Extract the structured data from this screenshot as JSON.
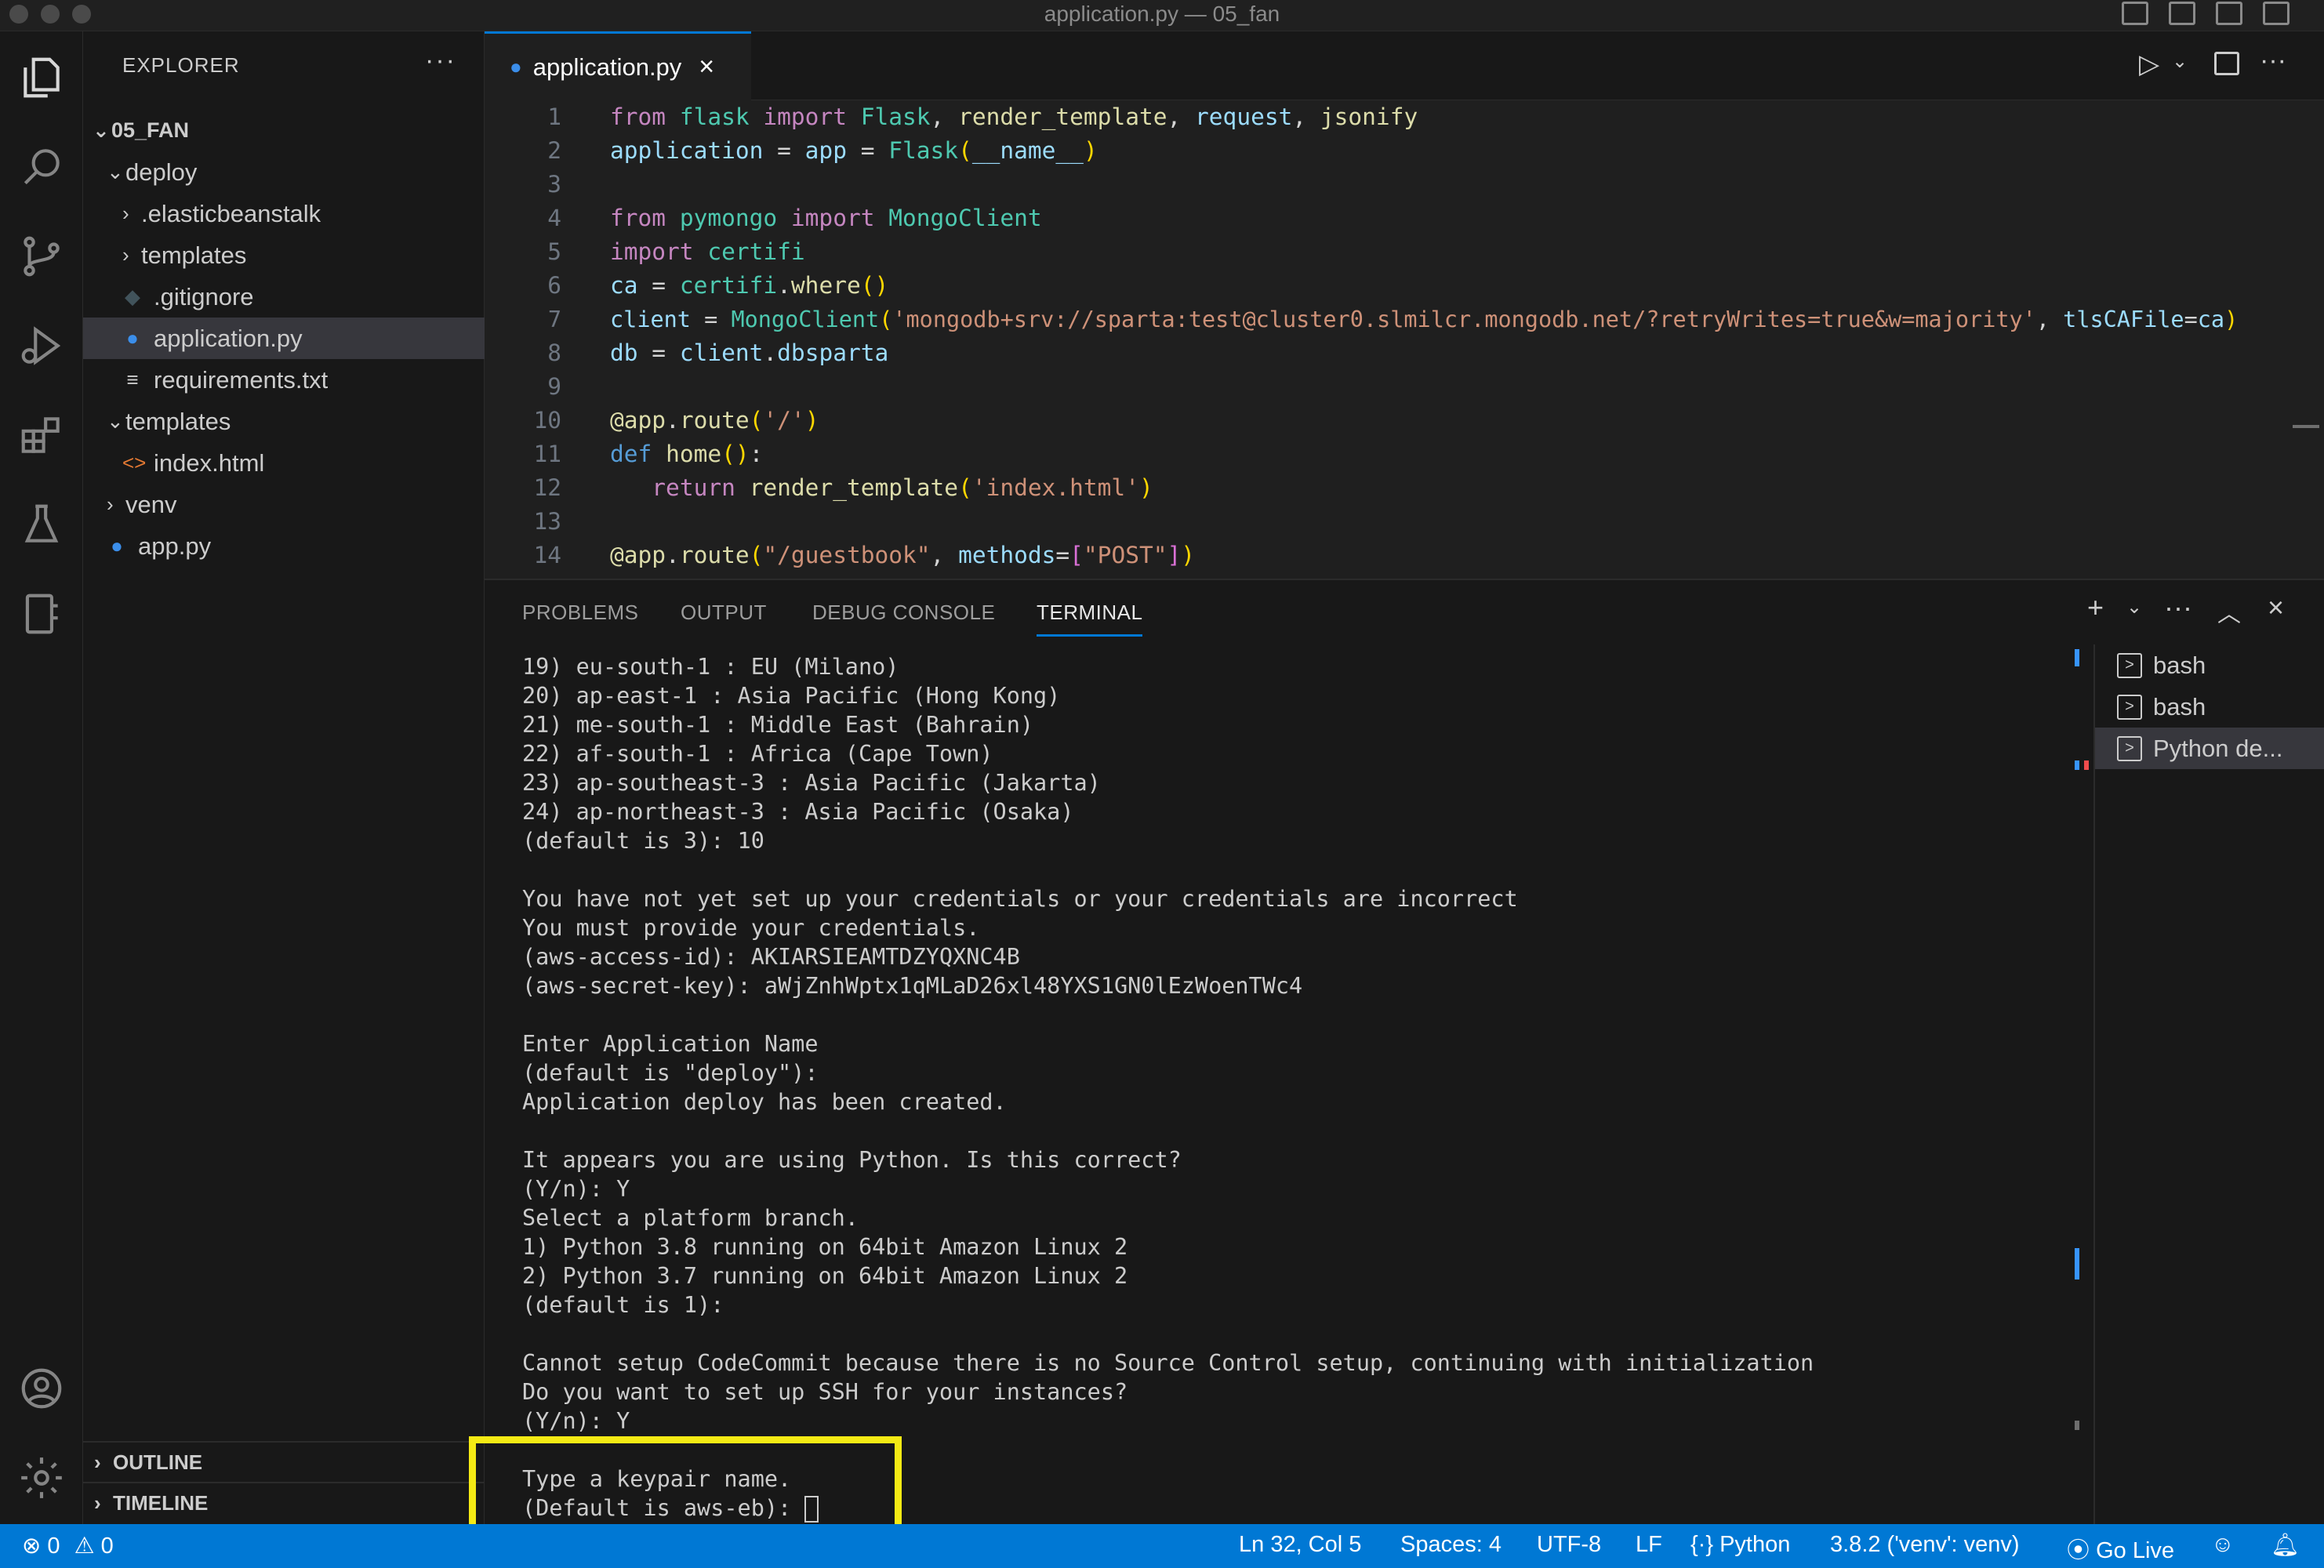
{
  "window": {
    "title": "application.py — 05_fan"
  },
  "sidebar": {
    "title": "EXPLORER",
    "more": "···",
    "tree": [
      {
        "label": "05_FAN",
        "kind": "root-folder"
      },
      {
        "label": "deploy",
        "kind": "folder-open"
      },
      {
        "label": ".elasticbeanstalk",
        "kind": "folder-closed"
      },
      {
        "label": "templates",
        "kind": "folder-closed"
      },
      {
        "label": ".gitignore",
        "kind": "git-file"
      },
      {
        "label": "application.py",
        "kind": "python-file"
      },
      {
        "label": "requirements.txt",
        "kind": "text-file"
      },
      {
        "label": "templates",
        "kind": "folder-open"
      },
      {
        "label": "index.html",
        "kind": "html-file"
      },
      {
        "label": "venv",
        "kind": "folder-closed"
      },
      {
        "label": "app.py",
        "kind": "python-file"
      }
    ],
    "outline": "OUTLINE",
    "timeline": "TIMELINE"
  },
  "editor": {
    "tab_label": "application.py",
    "lines": [
      {
        "n": "1",
        "text": "from flask import Flask, render_template, request, jsonify"
      },
      {
        "n": "2",
        "text": "application = app = Flask(__name__)"
      },
      {
        "n": "3",
        "text": ""
      },
      {
        "n": "4",
        "text": "from pymongo import MongoClient"
      },
      {
        "n": "5",
        "text": "import certifi"
      },
      {
        "n": "6",
        "text": "ca = certifi.where()"
      },
      {
        "n": "7",
        "text": "client = MongoClient('mongodb+srv://sparta:test@cluster0.slmilcr.mongodb.net/?retryWrites=true&w=majority', tlsCAFile=ca)"
      },
      {
        "n": "8",
        "text": "db = client.dbsparta"
      },
      {
        "n": "9",
        "text": ""
      },
      {
        "n": "10",
        "text": "@app.route('/')"
      },
      {
        "n": "11",
        "text": "def home():"
      },
      {
        "n": "12",
        "text": "   return render_template('index.html')"
      },
      {
        "n": "13",
        "text": ""
      },
      {
        "n": "14",
        "text": "@app.route(\"/guestbook\", methods=[\"POST\"])"
      }
    ]
  },
  "panel": {
    "tabs": [
      "PROBLEMS",
      "OUTPUT",
      "DEBUG CONSOLE",
      "TERMINAL"
    ],
    "active_tab": "TERMINAL",
    "terminal_lines": [
      "19) eu-south-1 : EU (Milano)",
      "20) ap-east-1 : Asia Pacific (Hong Kong)",
      "21) me-south-1 : Middle East (Bahrain)",
      "22) af-south-1 : Africa (Cape Town)",
      "23) ap-southeast-3 : Asia Pacific (Jakarta)",
      "24) ap-northeast-3 : Asia Pacific (Osaka)",
      "(default is 3): 10",
      "",
      "You have not yet set up your credentials or your credentials are incorrect",
      "You must provide your credentials.",
      "(aws-access-id): AKIARSIEAMTDZYQXNC4B",
      "(aws-secret-key): aWjZnhWptx1qMLaD26xl48YXS1GN0lEzWoenTWc4",
      "",
      "Enter Application Name",
      "(default is \"deploy\"):",
      "Application deploy has been created.",
      "",
      "It appears you are using Python. Is this correct?",
      "(Y/n): Y",
      "Select a platform branch.",
      "1) Python 3.8 running on 64bit Amazon Linux 2",
      "2) Python 3.7 running on 64bit Amazon Linux 2",
      "(default is 1):",
      "",
      "Cannot setup CodeCommit because there is no Source Control setup, continuing with initialization",
      "Do you want to set up SSH for your instances?",
      "(Y/n): Y",
      "",
      "Type a keypair name.",
      "(Default is aws-eb): "
    ],
    "terminals": [
      "bash",
      "bash",
      "Python de..."
    ]
  },
  "statusbar": {
    "errors": "0",
    "warnings": "0",
    "position": "Ln 32, Col 5",
    "spaces": "Spaces: 4",
    "encoding": "UTF-8",
    "eol": "LF",
    "language": "Python",
    "interpreter": "3.8.2 ('venv': venv)",
    "golive": "Go Live"
  },
  "colors": {
    "accent": "#0078d4",
    "highlight": "#f5ea14"
  }
}
